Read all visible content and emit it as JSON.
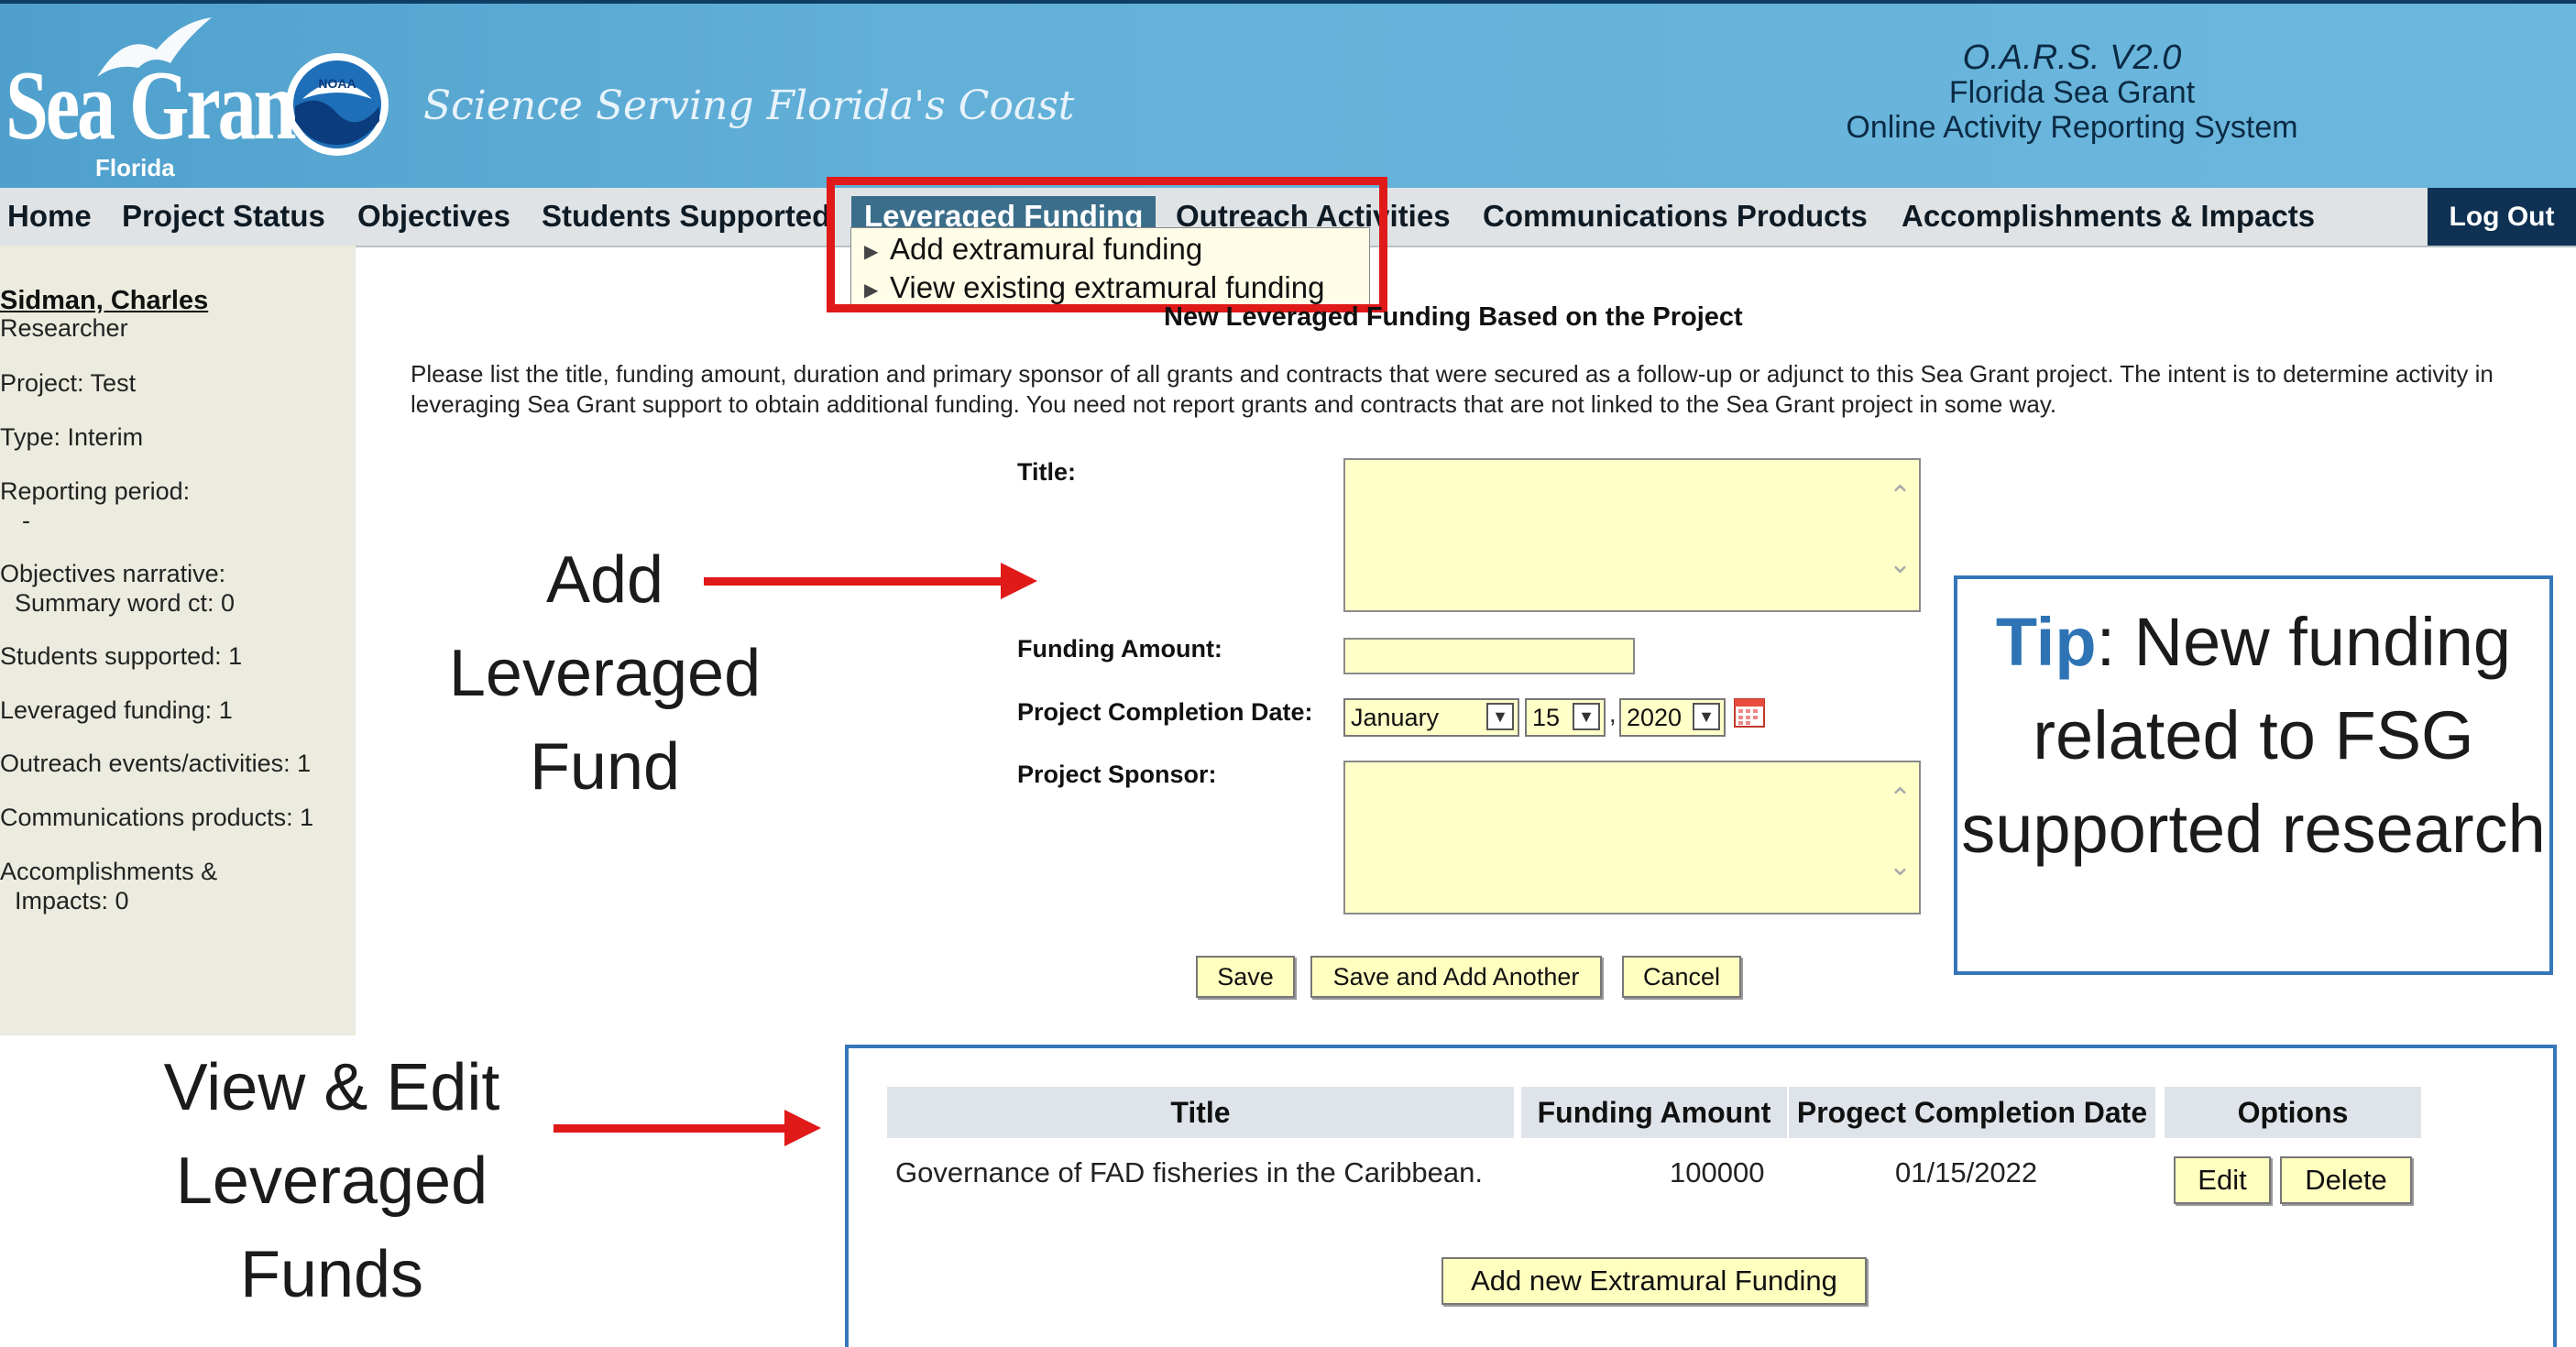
{
  "header": {
    "logo_text": "Sea Grant",
    "logo_sub": "Florida",
    "noaa_label": "NOAA",
    "tagline": "Science Serving Florida's Coast",
    "app_version": "O.A.R.S. V2.0",
    "app_org": "Florida Sea Grant",
    "app_name": "Online Activity Reporting System"
  },
  "nav": {
    "items": [
      "Home",
      "Project Status",
      "Objectives",
      "Students Supported",
      "Leveraged Funding",
      "Outreach Activities",
      "Communications Products",
      "Accomplishments & Impacts"
    ],
    "active": "Leveraged Funding",
    "logout": "Log Out",
    "dropdown": [
      "Add extramural funding",
      "View existing extramural funding"
    ]
  },
  "sidebar": {
    "name": "Sidman, Charles",
    "role": "Researcher",
    "project": "Project: Test",
    "type": "Type: Interim",
    "reporting_period": "Reporting period:",
    "reporting_value": "-",
    "objectives_narrative": "Objectives narrative:",
    "summary_word_ct": "Summary word ct: 0",
    "students": "Students supported: 1",
    "leveraged": "Leveraged funding: 1",
    "outreach": "Outreach events/activities: 1",
    "communications": "Communications products: 1",
    "accomplishments_1": "Accomplishments &",
    "accomplishments_2": "Impacts: 0"
  },
  "form": {
    "title": "New Leveraged Funding Based on the Project",
    "intro": "Please list the title, funding amount, duration and primary sponsor of all grants and contracts that were secured as a follow-up or adjunct to this Sea Grant project. The intent is to determine activity in leveraging Sea Grant support to obtain additional funding. You need not report grants and contracts that are not linked to the Sea Grant project in some way.",
    "title_label": "Title:",
    "amount_label": "Funding Amount:",
    "date_label": "Project Completion Date:",
    "sponsor_label": "Project Sponsor:",
    "month": "January",
    "day": "15",
    "year": "2020",
    "date_sep": ",",
    "save": "Save",
    "save_add": "Save and Add Another",
    "cancel": "Cancel"
  },
  "annotations": {
    "add_fund": [
      "Add",
      "Leveraged",
      "Fund"
    ],
    "view_edit": [
      "View  & Edit",
      "Leveraged",
      "Funds"
    ],
    "tip_word": "Tip",
    "tip_text": ": New funding related to FSG supported research"
  },
  "table": {
    "headers": [
      "Title",
      "Funding Amount",
      "Progect Completion Date",
      "Options"
    ],
    "rows": [
      {
        "title": "Governance of FAD fisheries in the Caribbean.",
        "amount": "100000",
        "date": "01/15/2022",
        "edit": "Edit",
        "delete": "Delete"
      }
    ],
    "add_button": "Add new Extramural Funding"
  },
  "colors": {
    "header_blue": "#62b0d8",
    "nav_active": "#3a6e8a",
    "highlight_red": "#e01919",
    "field_yellow": "#ffffc8",
    "tip_blue": "#2e74b5"
  }
}
